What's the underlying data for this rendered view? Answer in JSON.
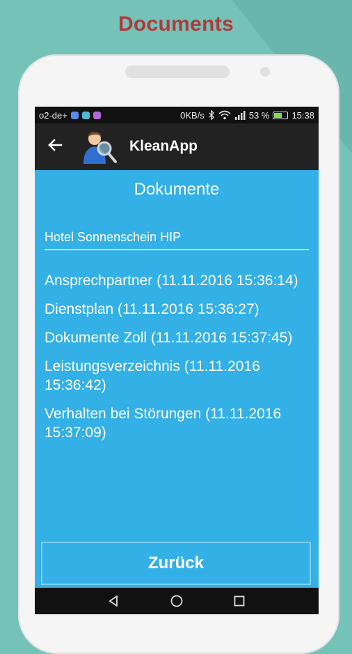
{
  "promo": {
    "title": "Documents"
  },
  "statusbar": {
    "carrier": "o2-de+",
    "speed": "0KB/s",
    "battery_percent": "53 %",
    "battery_level": 0.53,
    "time": "15:38",
    "notif_colors": [
      "#5a8cf0",
      "#4fbcd4",
      "#b06ad6"
    ]
  },
  "appbar": {
    "title": "KleanApp"
  },
  "page": {
    "heading": "Dokumente",
    "hotel": "Hotel Sonnenschein HIP",
    "documents": [
      {
        "label": "Ansprechpartner (11.11.2016 15:36:14)"
      },
      {
        "label": "Dienstplan (11.11.2016 15:36:27)"
      },
      {
        "label": "Dokumente Zoll (11.11.2016 15:37:45)"
      },
      {
        "label": "Leistungsverzeichnis (11.11.2016 15:36:42)"
      },
      {
        "label": "Verhalten bei Störungen (11.11.2016 15:37:09)"
      }
    ],
    "back_button_label": "Zurück"
  },
  "colors": {
    "background": "#74c2b8",
    "promo_title": "#b03a3a",
    "screen": "#33b0e6",
    "appbar": "#222222"
  }
}
